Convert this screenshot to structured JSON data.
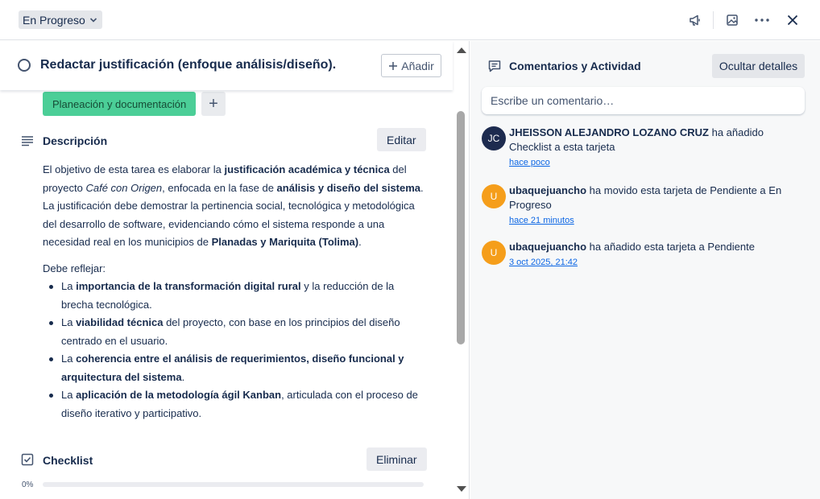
{
  "colors": {
    "label": "#4bce97",
    "avatar_jc": "#1d2b4f",
    "avatar_u": "#f59e1b",
    "link": "#0c66e4"
  },
  "header": {
    "status_label": "En Progreso",
    "icons": [
      "chevron-down-icon",
      "megaphone-icon",
      "image-icon",
      "more-icon",
      "close-icon"
    ]
  },
  "card": {
    "title": "Redactar justificación (enfoque análisis/diseño).",
    "add_label": "Añadir",
    "label": "Planeación y documentación",
    "label_add": "+"
  },
  "description": {
    "heading": "Descripción",
    "edit_label": "Editar",
    "p1": {
      "t1": "El objetivo de esta tarea es elaborar la ",
      "b1": "justificación académica y técnica",
      "t2": " del proyecto ",
      "i1": "Café con Origen",
      "t3": ", enfocada en la fase de ",
      "b2": "análisis y diseño del sistema",
      "t4": ". La justificación debe demostrar la pertinencia social, tecnológica y metodológica del desarrollo de software, evidenciando cómo el sistema responde a una necesidad real en los municipios de ",
      "b3": "Planadas y Mariquita (Tolima)",
      "t5": "."
    },
    "p2": "Debe reflejar:",
    "bullets": [
      {
        "pre": "La ",
        "bold": "importancia de la transformación digital rural",
        "post": " y la reducción de la brecha tecnológica."
      },
      {
        "pre": "La ",
        "bold": "viabilidad técnica",
        "post": " del proyecto, con base en los principios del diseño centrado en el usuario."
      },
      {
        "pre": "La ",
        "bold": "coherencia entre el análisis de requerimientos, diseño funcional y arquitectura del sistema",
        "post": "."
      },
      {
        "pre": "La ",
        "bold": "aplicación de la metodología ágil Kanban",
        "post": ", articulada con el proceso de diseño iterativo y participativo."
      }
    ]
  },
  "checklist": {
    "heading": "Checklist",
    "delete_label": "Eliminar",
    "progress_text": "0%",
    "progress": 0
  },
  "activity": {
    "heading": "Comentarios y Actividad",
    "hide_label": "Ocultar detalles",
    "comment_placeholder": "Escribe un comentario…",
    "items": [
      {
        "initials": "JC",
        "user": "JHEISSON ALEJANDRO LOZANO CRUZ",
        "action": " ha añadido Checklist a esta tarjeta",
        "time": "hace poco"
      },
      {
        "initials": "U",
        "user": "ubaquejuancho",
        "action": " ha movido esta tarjeta de Pendiente a En Progreso",
        "time": "hace 21 minutos"
      },
      {
        "initials": "U",
        "user": "ubaquejuancho",
        "action": " ha añadido esta tarjeta a Pendiente",
        "time": "3 oct 2025, 21:42"
      }
    ]
  }
}
